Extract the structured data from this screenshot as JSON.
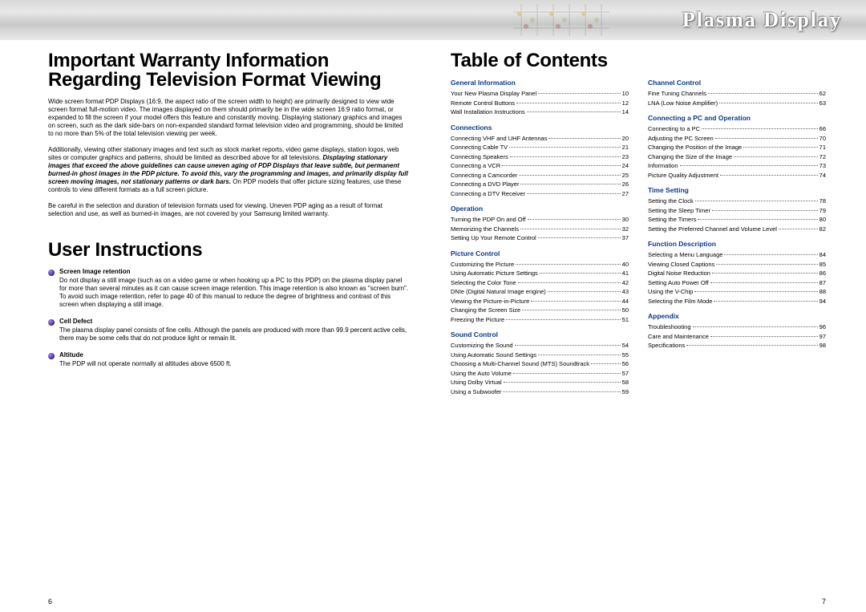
{
  "header": {
    "title": "Plasma Display"
  },
  "left": {
    "heading1a": "Important Warranty Information",
    "heading1b": "Regarding Television Format Viewing",
    "p1": "Wide screen format PDP Displays (16:9, the aspect ratio of the screen width to height) are primarily designed to view wide screen format full-motion video. The images displayed on them should primarily be in the wide screen 16:9 ratio format, or expanded to fill the screen if your model offers this feature and constantly moving. Displaying stationary graphics and images on screen, such as the dark side-bars on non-expanded standard format television video and programming, should be limited to no more than 5% of the total television viewing per week.",
    "p2a": "Additionally, viewing other stationary images and text such as stock market reports, video game displays, station logos, web sites or computer graphics and patterns, should be limited as described above for all televisions. ",
    "p2b": "Displaying stationary images that exceed the above guidelines can cause uneven aging of PDP Displays that leave subtle, but permanent burned-in ghost images in the PDP picture. To avoid this, vary the programming and images, and primarily display full screen moving images, not stationary patterns or dark bars.",
    "p2c": " On PDP models that offer picture sizing features, use these controls to view different formats as a full screen picture.",
    "p3": "Be careful in the selection and duration of television formats used for viewing. Uneven PDP aging as a result of format selection and use, as well as burned-in images, are not covered by your Samsung limited warranty.",
    "heading2": "User Instructions",
    "instr": [
      {
        "title": "Screen Image retention",
        "body": "Do not display a still image (such as on a video game or when hooking up a PC to this PDP) on the plasma display panel for more than several minutes as it can cause screen image retention. This image retention is also known as \"screen burn\". To avoid such image retention, refer to page 40 of this manual to reduce the degree of brightness and contrast of this screen when displaying a still image."
      },
      {
        "title": "Cell Defect",
        "body": "The plasma display panel consists of fine cells. Although the panels are produced with more than 99.9 percent active cells, there may be some cells that do not produce light or remain lit."
      },
      {
        "title": "Altitude",
        "body": "The PDP will not operate normally at altitudes above 6500 ft."
      }
    ],
    "pagenum": "6"
  },
  "right": {
    "heading": "Table of Contents",
    "col1": [
      {
        "section": "General Information"
      },
      {
        "label": "Your New Plasma Display Panel",
        "page": "10"
      },
      {
        "label": "Remote Control Buttons",
        "page": "12"
      },
      {
        "label": "Wall Installation Instructions",
        "page": "14"
      },
      {
        "section": "Connections"
      },
      {
        "label": "Connecting VHF and UHF Antennas",
        "page": "20"
      },
      {
        "label": "Connecting Cable TV",
        "page": "21"
      },
      {
        "label": "Connecting Speakers",
        "page": "23"
      },
      {
        "label": "Connecting a VCR",
        "page": "24"
      },
      {
        "label": "Connecting a Camcorder",
        "page": "25"
      },
      {
        "label": "Connecting a DVD Player",
        "page": "26"
      },
      {
        "label": "Connecting a DTV Receiver",
        "page": "27"
      },
      {
        "section": "Operation"
      },
      {
        "label": "Turning the PDP On and Off",
        "page": "30"
      },
      {
        "label": "Memorizing the Channels",
        "page": "32"
      },
      {
        "label": "Setting Up Your Remote Control",
        "page": "37"
      },
      {
        "section": "Picture Control"
      },
      {
        "label": "Customizing the Picture",
        "page": "40"
      },
      {
        "label": "Using Automatic Picture Settings",
        "page": "41"
      },
      {
        "label": "Selecting the Color Tone",
        "page": "42"
      },
      {
        "label": "DNIe (Digital Natural Image engine)",
        "page": "43"
      },
      {
        "label": "Viewing the Picture-in-Picture",
        "page": "44"
      },
      {
        "label": "Changing the Screen Size",
        "page": "50"
      },
      {
        "label": "Freezing the Picture",
        "page": "51"
      },
      {
        "section": "Sound Control"
      },
      {
        "label": "Customizing the Sound",
        "page": "54"
      },
      {
        "label": "Using Automatic Sound Settings",
        "page": "55"
      },
      {
        "label": "Choosing a Multi-Channel Sound (MTS) Soundtrack",
        "page": "56"
      },
      {
        "label": "Using the Auto Volume",
        "page": "57"
      },
      {
        "label": "Using Dolby Virtual",
        "page": "58"
      },
      {
        "label": "Using a Subwoofer",
        "page": "59"
      }
    ],
    "col2": [
      {
        "section": "Channel Control"
      },
      {
        "label": "Fine Tuning Channels",
        "page": "62"
      },
      {
        "label": "LNA (Low Noise Amplifier)",
        "page": "63"
      },
      {
        "section": "Connecting a PC and Operation"
      },
      {
        "label": "Connecting to a PC",
        "page": "66"
      },
      {
        "label": "Adjusting the PC Screen",
        "page": "70"
      },
      {
        "label": "Changing the Position of the Image",
        "page": "71"
      },
      {
        "label": "Changing the Size of the Image",
        "page": "72"
      },
      {
        "label": "Information",
        "page": "73"
      },
      {
        "label": "Picture Quality Adjustment",
        "page": "74"
      },
      {
        "section": "Time Setting"
      },
      {
        "label": "Setting the Clock",
        "page": "78"
      },
      {
        "label": "Setting the Sleep Timer",
        "page": "79"
      },
      {
        "label": "Setting the Timers",
        "page": "80"
      },
      {
        "label": "Setting the Preferred Channel and Volume Level",
        "page": "82"
      },
      {
        "section": "Function Description"
      },
      {
        "label": "Selecting a Menu Language",
        "page": "84"
      },
      {
        "label": "Viewing Closed Captions",
        "page": "85"
      },
      {
        "label": "Digital Noise Reduction",
        "page": "86"
      },
      {
        "label": "Setting Auto Power Off",
        "page": "87"
      },
      {
        "label": "Using the V-Chip",
        "page": "88"
      },
      {
        "label": "Selecting the Film Mode",
        "page": "94"
      },
      {
        "section": "Appendix"
      },
      {
        "label": "Troubleshooting",
        "page": "96"
      },
      {
        "label": "Care and Maintenance",
        "page": "97"
      },
      {
        "label": "Specifications",
        "page": "98"
      }
    ],
    "pagenum": "7"
  }
}
